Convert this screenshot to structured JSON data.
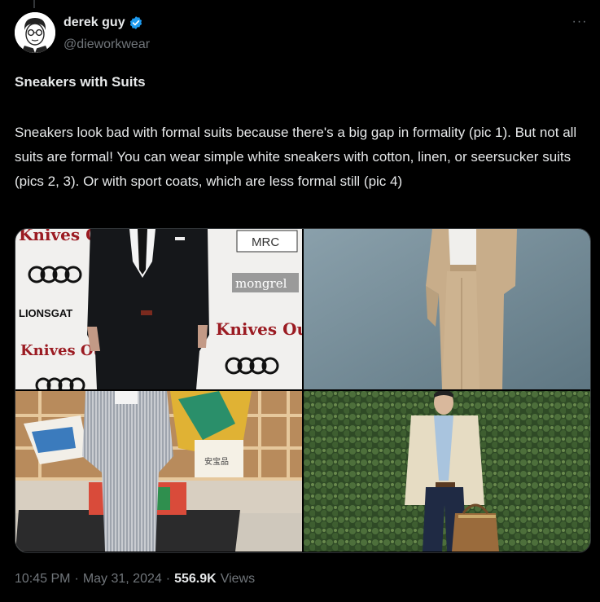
{
  "author": {
    "display_name": "derek guy",
    "handle": "@dieworkwear",
    "verified": true,
    "avatar_icon": "avatar-illustration",
    "verified_color": "#1d9bf0"
  },
  "post": {
    "title": "Sneakers with Suits",
    "body": "Sneakers look bad with formal suits because there's a big gap in formality (pic 1). But not all suits are formal! You can wear simple white sneakers with cotton, linen, or seersucker suits (pics 2, 3). Or with sport coats, which are less formal still (pic 4)"
  },
  "media": {
    "pic1": {
      "backdrop_text_1": "Knives Ou",
      "backdrop_text_2": "Knives Out",
      "backdrop_text_3": "Knives Ou",
      "sponsor_1": "MRC",
      "sponsor_2": "mongrel",
      "sponsor_3": "LIONSGAT"
    },
    "pic3": {
      "sign_text": "安宝品"
    }
  },
  "meta": {
    "time": "10:45 PM",
    "separator": "·",
    "date": "May 31, 2024",
    "views_count": "556.9K",
    "views_label": "Views"
  },
  "menu": {
    "more_label": "···"
  }
}
